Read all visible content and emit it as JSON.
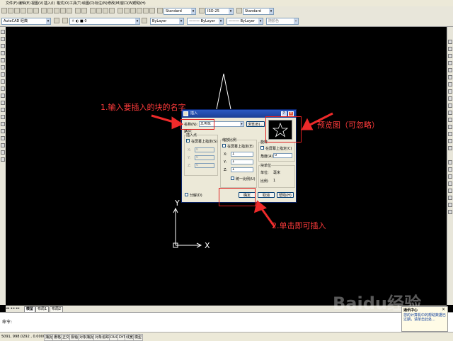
{
  "menu": [
    "文件(F)",
    "编辑(E)",
    "视图(V)",
    "插入(I)",
    "格式(O)",
    "工具(T)",
    "绘图(D)",
    "标注(N)",
    "修改(M)",
    "窗口(W)",
    "帮助(H)"
  ],
  "toolbar1": {
    "text_style": "Standard",
    "dim_style": "ISO-25",
    "table_style": "Standard"
  },
  "toolbar2": {
    "workspace": "AutoCAD 经典",
    "layer_color": "ByLayer",
    "linetype": "ByLayer",
    "lineweight": "ByLayer",
    "plot_style": "随颜色"
  },
  "canvas": {
    "ucs_x": "X",
    "ucs_y": "Y"
  },
  "tabs": [
    "模型",
    "布局1",
    "布局2"
  ],
  "command": {
    "prompt": "命令:"
  },
  "status": {
    "coords": "5091, 998.0292 , 0.0000",
    "toggles": [
      "捕捉",
      "栅格",
      "正交",
      "极轴",
      "对象捕捉",
      "对象追踪",
      "DUCS",
      "DYN",
      "线宽",
      "模型"
    ]
  },
  "dialog": {
    "title": "插入",
    "name_label": "名称(N):",
    "name_value": "五角星",
    "browse_label": "浏览(B)...",
    "path_label": "路径:",
    "insert_point": {
      "group": "插入点",
      "on_screen": "在屏幕上指定(S)",
      "x_label": "X:",
      "x_value": "0",
      "y_label": "Y:",
      "y_value": "0",
      "z_label": "Z:",
      "z_value": "0"
    },
    "scale": {
      "group": "缩放比例",
      "on_screen": "在屏幕上指定(E)",
      "x_label": "X:",
      "x_value": "1",
      "y_label": "Y:",
      "y_value": "1",
      "z_label": "Z:",
      "z_value": "1",
      "uniform": "统一比例(U)"
    },
    "rotation": {
      "group": "旋转",
      "on_screen": "在屏幕上指定(C)",
      "angle_label": "角度(A):",
      "angle_value": "0"
    },
    "block_unit": {
      "group": "块单位",
      "unit_label": "单位:",
      "unit_value": "毫米",
      "factor_label": "比例:",
      "factor_value": "1"
    },
    "explode_label": "分解(D)",
    "ok_label": "确定",
    "cancel_label": "取消",
    "help_label": "帮助(H)"
  },
  "annotations": {
    "step1": "1.输入要插入的块的名字",
    "preview": "预览图（可忽略）",
    "step2": "2.单击即可插入"
  },
  "watermark": {
    "brand": "Baidu经验",
    "url": "jingyan.baidu.com"
  },
  "popup": {
    "title": "通讯中心",
    "text": "您的计算机中的帮助数据已过期，请单击此处..."
  },
  "colors": {
    "annotation_red": "#ff3b3b",
    "title_blue": "#1c3f94",
    "canvas_bg": "#000000"
  }
}
